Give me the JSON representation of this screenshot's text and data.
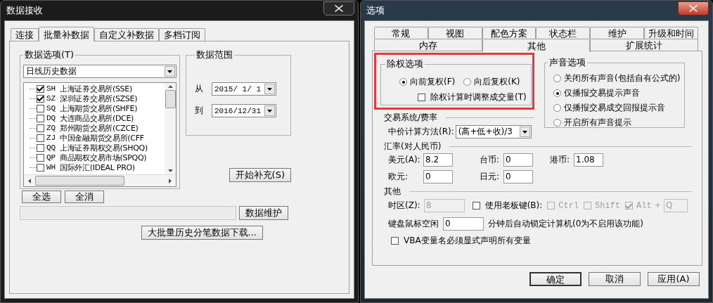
{
  "left_window": {
    "title": "数据接收",
    "tabs": [
      {
        "label": "连接",
        "selected": false
      },
      {
        "label": "批量补数据",
        "selected": true
      },
      {
        "label": "自定义补数据",
        "selected": false
      },
      {
        "label": "多档订阅",
        "selected": false
      }
    ],
    "data_options": {
      "title": "数据选项(T)",
      "dropdown": "日线历史数据",
      "markets": [
        {
          "code": "SH",
          "name": "上海证券交易所(SSE)",
          "checked": true
        },
        {
          "code": "SZ",
          "name": "深圳证券交易所(SZSE)",
          "checked": true
        },
        {
          "code": "SQ",
          "name": "上海期货交易所(SHFE)",
          "checked": false
        },
        {
          "code": "DQ",
          "name": "大连商品交易所(DCE)",
          "checked": false
        },
        {
          "code": "ZQ",
          "name": "郑州期货交易所(CZCE)",
          "checked": false
        },
        {
          "code": "ZJ",
          "name": "中国金融期货交易所(CFF",
          "checked": false
        },
        {
          "code": "QQ",
          "name": "上海证券期权交易(SHQQ)",
          "checked": false
        },
        {
          "code": "QP",
          "name": "商品期权交易市场(SPQQ)",
          "checked": false
        },
        {
          "code": "WH",
          "name": "国际外汇(IDEAL PRO)",
          "checked": false
        }
      ]
    },
    "data_range": {
      "title": "数据范围",
      "from_label": "从",
      "from": "2015/ 1/ 1",
      "to_label": "到",
      "to": "2016/12/31"
    },
    "progress": {
      "level": 0
    },
    "select_all": "全选",
    "clear_all": "全消",
    "start_button": "开始补充(S)",
    "maintain_button": "数据维护",
    "bulk_download_button": "大批量历史分笔数据下载..."
  },
  "right_window": {
    "title": "选项",
    "tab_rows": [
      [
        {
          "label": "常规",
          "selected": false
        },
        {
          "label": "视图",
          "selected": false
        },
        {
          "label": "配色方案",
          "selected": false
        },
        {
          "label": "状态栏",
          "selected": false
        },
        {
          "label": "维护",
          "selected": false
        },
        {
          "label": "升级和时间",
          "selected": false
        }
      ],
      [
        {
          "label": "内存",
          "selected": false
        },
        {
          "label": "其他",
          "selected": true
        },
        {
          "label": "扩展统计",
          "selected": false
        }
      ]
    ],
    "adjust": {
      "title": "除权选项",
      "highlighted": true,
      "radios": [
        {
          "label": "向前复权(F)",
          "selected": true
        },
        {
          "label": "向后复权(K)",
          "selected": false
        }
      ],
      "checkbox": {
        "label": "除权计算时调整成交量(T)",
        "checked": false
      }
    },
    "sound": {
      "title": "声音选项",
      "radios": [
        {
          "label": "关闭所有声音(包括自有公式的)",
          "selected": false
        },
        {
          "label": "仅播报交易提示声音",
          "selected": true
        },
        {
          "label": "仅播报交易成交回报提示音",
          "selected": false
        },
        {
          "label": "开启所有声音提示",
          "selected": false
        }
      ]
    },
    "trading": {
      "title": "交易系统/费率",
      "mid_price_label": "中价计算方法(R):",
      "mid_price_value": "(高+低+收)/3"
    },
    "rates": {
      "title": "汇率(对人民币)",
      "fields": [
        {
          "label": "美元(A):",
          "value": "8.2"
        },
        {
          "label": "台币:",
          "value": "0"
        },
        {
          "label": "港币:",
          "value": "1.08"
        },
        {
          "label": "欧元:",
          "value": "0"
        },
        {
          "label": "日元:",
          "value": "0"
        }
      ]
    },
    "other": {
      "title": "其他",
      "timezone": {
        "label": "时区(Z):",
        "value": "8",
        "disabled": true
      },
      "boss_key": {
        "label": "使用老板键(B):",
        "checked": false
      },
      "modifiers": [
        {
          "label": "Ctrl",
          "checked": false,
          "disabled": true
        },
        {
          "label": "Shift",
          "checked": false,
          "disabled": true
        },
        {
          "label": "Alt",
          "checked": true,
          "disabled": true
        }
      ],
      "plus": "+",
      "hotkey": {
        "value": "Q",
        "disabled": true
      },
      "idle_label": "键盘鼠标空闲",
      "idle_value": "0",
      "idle_suffix": "分钟后自动锁定计算机(0为不启用该功能)",
      "vba": {
        "label": "VBA变量名必须显式声明所有变量",
        "checked": false
      }
    },
    "buttons": [
      "确定",
      "取消",
      "应用(A)"
    ]
  }
}
